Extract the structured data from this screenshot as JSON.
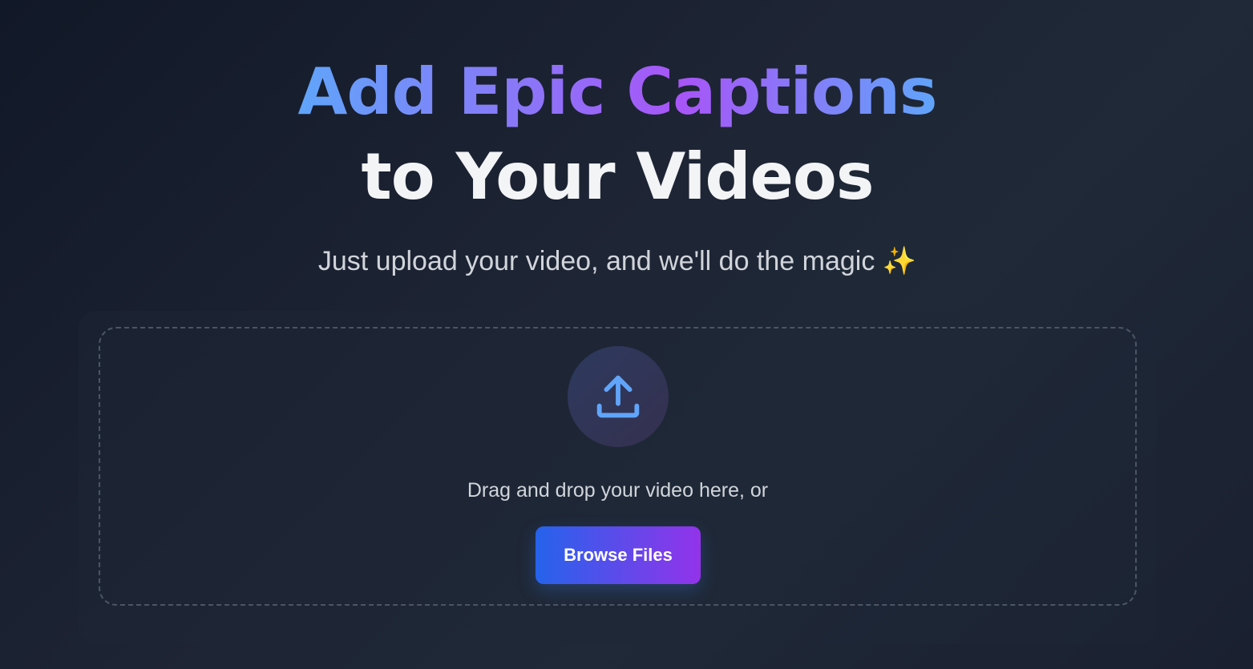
{
  "hero": {
    "headline_gradient": "Add Epic Captions",
    "headline_plain": "to Your Videos",
    "subtitle": "Just upload your video, and we'll do the magic ✨"
  },
  "upload": {
    "icon": "upload-icon",
    "instruction": "Drag and drop your video here, or",
    "browse_label": "Browse Files"
  },
  "colors": {
    "gradient_start": "#60a5fa",
    "gradient_mid": "#a855f7",
    "button_start": "#2563eb",
    "button_end": "#9333ea",
    "icon_color": "#60a5fa"
  }
}
